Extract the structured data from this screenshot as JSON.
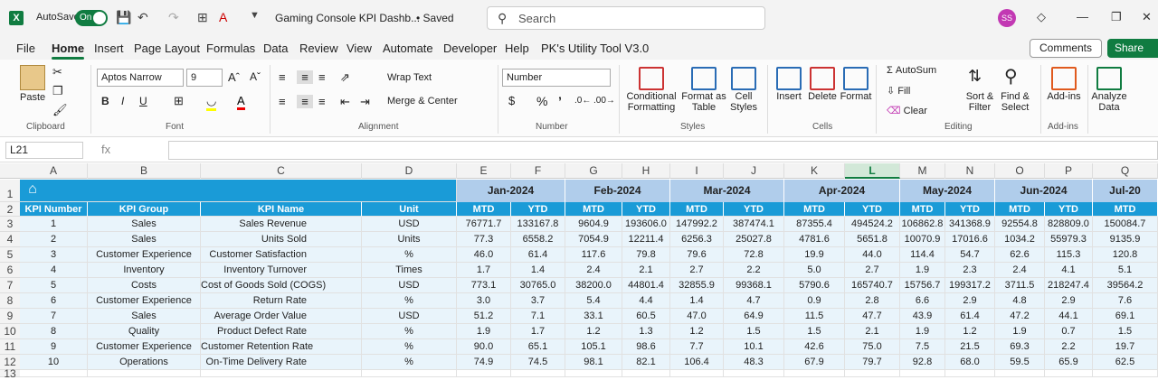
{
  "titlebar": {
    "autosave_label": "AutoSave",
    "autosave_state": "On",
    "doc_title": "Gaming Console KPI Dashb...",
    "saved_status": "• Saved",
    "search_placeholder": "Search",
    "avatar_initials": "SS"
  },
  "menu": {
    "items": [
      "File",
      "Home",
      "Insert",
      "Page Layout",
      "Formulas",
      "Data",
      "Review",
      "View",
      "Automate",
      "Developer",
      "Help",
      "PK's Utility Tool V3.0"
    ],
    "active": "Home",
    "comments": "Comments",
    "share": "Share"
  },
  "ribbon": {
    "paste": "Paste",
    "clipboard": "Clipboard",
    "font_name": "Aptos Narrow",
    "font_size": "9",
    "font": "Font",
    "wrap_text": "Wrap Text",
    "merge_center": "Merge & Center",
    "alignment": "Alignment",
    "number_format": "Number",
    "number": "Number",
    "conditional_formatting_1": "Conditional",
    "conditional_formatting_2": "Formatting",
    "format_as_table_1": "Format as",
    "format_as_table_2": "Table",
    "cell_styles_1": "Cell",
    "cell_styles_2": "Styles",
    "styles": "Styles",
    "insert": "Insert",
    "delete": "Delete",
    "format": "Format",
    "cells": "Cells",
    "autosum": "AutoSum",
    "fill": "Fill",
    "clear": "Clear",
    "sort_filter_1": "Sort &",
    "sort_filter_2": "Filter",
    "find_select_1": "Find &",
    "find_select_2": "Select",
    "editing": "Editing",
    "addins": "Add-ins",
    "addins_group": "Add-ins",
    "analyze_1": "Analyze",
    "analyze_2": "Data"
  },
  "formula_bar": {
    "name_box": "L21",
    "fx": "fx",
    "formula": ""
  },
  "columns": [
    "A",
    "B",
    "C",
    "D",
    "E",
    "F",
    "G",
    "H",
    "I",
    "J",
    "K",
    "L",
    "M",
    "N",
    "O",
    "P",
    "Q"
  ],
  "selected_column": "L",
  "rows": [
    "1",
    "2",
    "3",
    "4",
    "5",
    "6",
    "7",
    "8",
    "9",
    "10",
    "11",
    "12",
    "13"
  ],
  "months": [
    "Jan-2024",
    "Feb-2024",
    "Mar-2024",
    "Apr-2024",
    "May-2024",
    "Jun-2024",
    "Jul-20"
  ],
  "headers": [
    "KPI Number",
    "KPI Group",
    "KPI Name",
    "Unit"
  ],
  "sub_headers": [
    "MTD",
    "YTD",
    "MTD",
    "YTD",
    "MTD",
    "YTD",
    "MTD",
    "YTD",
    "MTD",
    "YTD",
    "MTD",
    "YTD",
    "MTD"
  ],
  "table": [
    [
      "1",
      "Sales",
      "Sales Revenue",
      "USD",
      "76771.7",
      "133167.8",
      "9604.9",
      "193606.0",
      "147992.2",
      "387474.1",
      "87355.4",
      "494524.2",
      "106862.8",
      "341368.9",
      "92554.8",
      "828809.0",
      "150084.7"
    ],
    [
      "2",
      "Sales",
      "Units Sold",
      "Units",
      "77.3",
      "6558.2",
      "7054.9",
      "12211.4",
      "6256.3",
      "25027.8",
      "4781.6",
      "5651.8",
      "10070.9",
      "17016.6",
      "1034.2",
      "55979.3",
      "9135.9"
    ],
    [
      "3",
      "Customer Experience",
      "Customer Satisfaction",
      "%",
      "46.0",
      "61.4",
      "117.6",
      "79.8",
      "79.6",
      "72.8",
      "19.9",
      "44.0",
      "114.4",
      "54.7",
      "62.6",
      "115.3",
      "120.8"
    ],
    [
      "4",
      "Inventory",
      "Inventory Turnover",
      "Times",
      "1.7",
      "1.4",
      "2.4",
      "2.1",
      "2.7",
      "2.2",
      "5.0",
      "2.7",
      "1.9",
      "2.3",
      "2.4",
      "4.1",
      "5.1"
    ],
    [
      "5",
      "Costs",
      "Cost of Goods Sold (COGS)",
      "USD",
      "773.1",
      "30765.0",
      "38200.0",
      "44801.4",
      "32855.9",
      "99368.1",
      "5790.6",
      "165740.7",
      "15756.7",
      "199317.2",
      "3711.5",
      "218247.4",
      "39564.2"
    ],
    [
      "6",
      "Customer Experience",
      "Return Rate",
      "%",
      "3.0",
      "3.7",
      "5.4",
      "4.4",
      "1.4",
      "4.7",
      "0.9",
      "2.8",
      "6.6",
      "2.9",
      "4.8",
      "2.9",
      "7.6"
    ],
    [
      "7",
      "Sales",
      "Average Order Value",
      "USD",
      "51.2",
      "7.1",
      "33.1",
      "60.5",
      "47.0",
      "64.9",
      "11.5",
      "47.7",
      "43.9",
      "61.4",
      "47.2",
      "44.1",
      "69.1"
    ],
    [
      "8",
      "Quality",
      "Product Defect Rate",
      "%",
      "1.9",
      "1.7",
      "1.2",
      "1.3",
      "1.2",
      "1.5",
      "1.5",
      "2.1",
      "1.9",
      "1.2",
      "1.9",
      "0.7",
      "1.5"
    ],
    [
      "9",
      "Customer Experience",
      "Customer Retention Rate",
      "%",
      "90.0",
      "65.1",
      "105.1",
      "98.6",
      "7.7",
      "10.1",
      "42.6",
      "75.0",
      "7.5",
      "21.5",
      "69.3",
      "2.2",
      "19.7"
    ],
    [
      "10",
      "Operations",
      "On-Time Delivery Rate",
      "%",
      "74.9",
      "74.5",
      "98.1",
      "82.1",
      "106.4",
      "48.3",
      "67.9",
      "79.7",
      "92.8",
      "68.0",
      "59.5",
      "65.9",
      "62.5"
    ]
  ],
  "colors": {
    "header_blue": "#1a9bd7",
    "month_blue": "#b0cdeb",
    "excel_green": "#107c41"
  }
}
